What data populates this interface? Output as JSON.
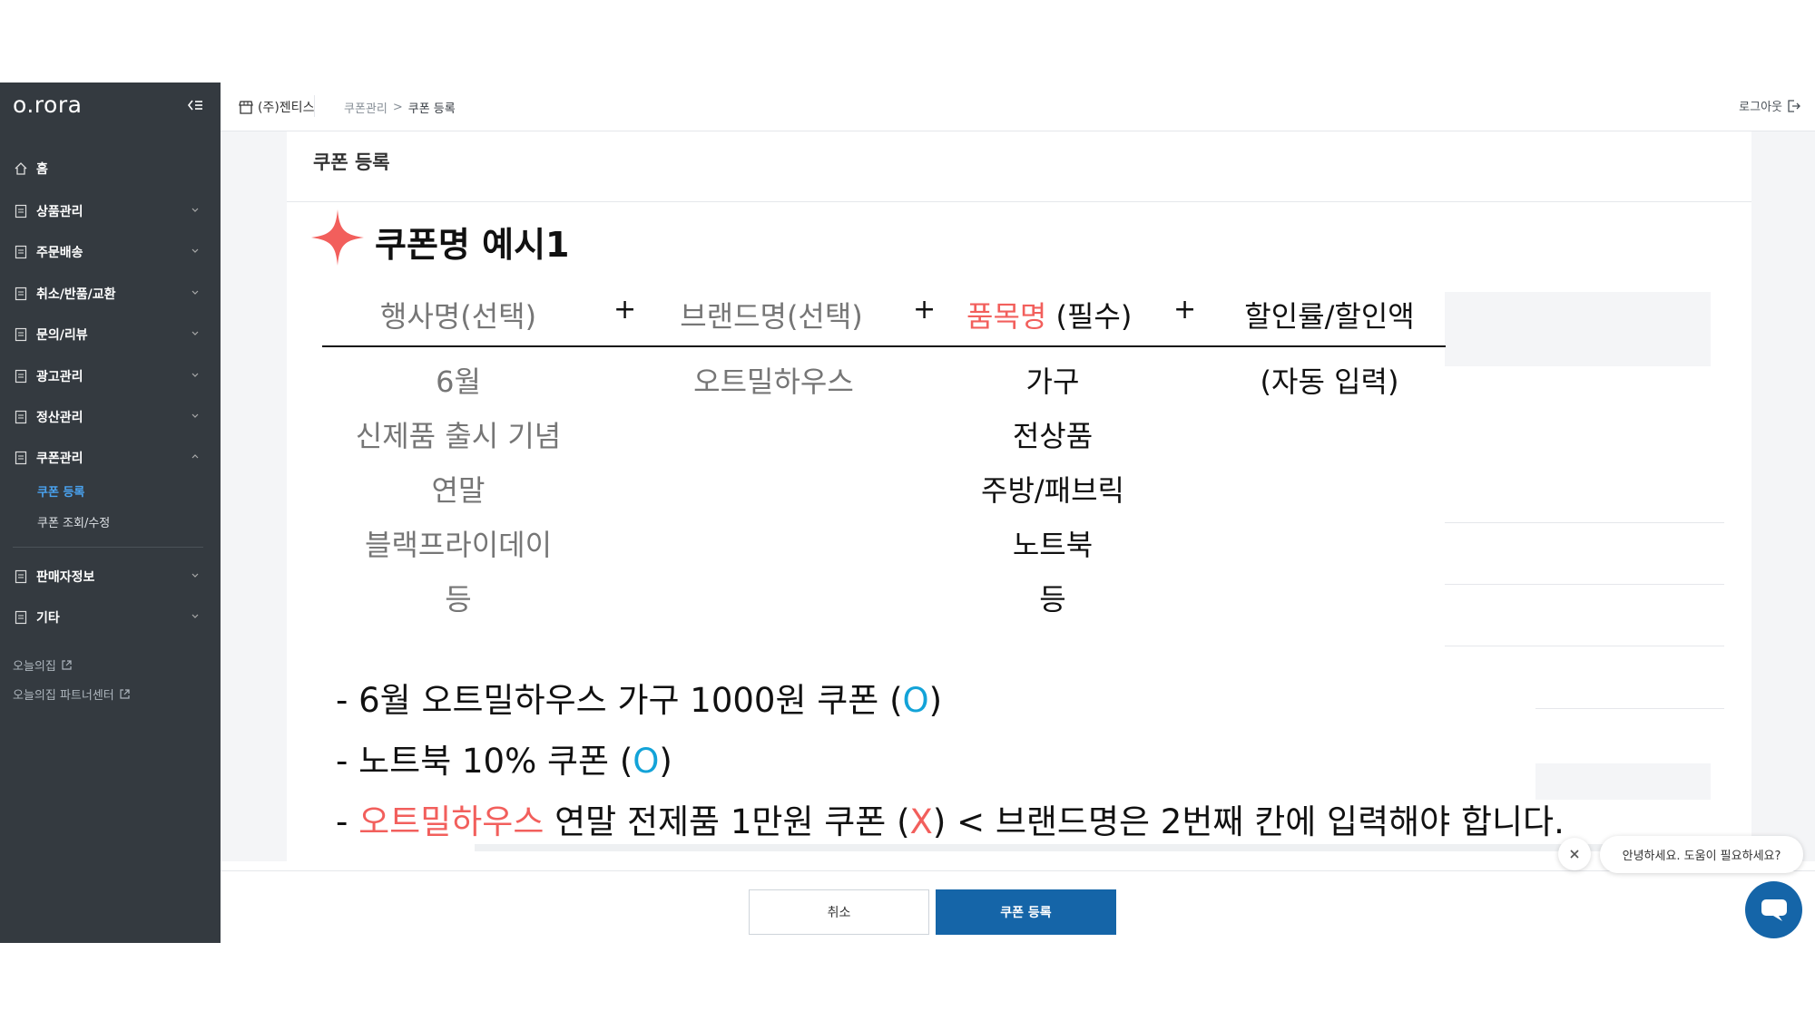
{
  "sidebar": {
    "logo": "o.rora",
    "items": [
      {
        "label": "홈"
      },
      {
        "label": "상품관리"
      },
      {
        "label": "주문배송"
      },
      {
        "label": "취소/반품/교환"
      },
      {
        "label": "문의/리뷰"
      },
      {
        "label": "광고관리"
      },
      {
        "label": "정산관리"
      },
      {
        "label": "쿠폰관리"
      },
      {
        "label": "판매자정보"
      },
      {
        "label": "기타"
      }
    ],
    "coupon_sub": [
      {
        "label": "쿠폰 등록",
        "active": true
      },
      {
        "label": "쿠폰 조회/수정",
        "active": false
      }
    ],
    "links": [
      {
        "label": "오늘의집"
      },
      {
        "label": "오늘의집 파트너센터"
      }
    ]
  },
  "header": {
    "company": "(주)젠티스",
    "breadcrumb": [
      "쿠폰관리",
      "쿠폰 등록"
    ],
    "logout": "로그아웃"
  },
  "page": {
    "title": "쿠폰 등록"
  },
  "example": {
    "title": "쿠폰명 예시1",
    "headers": {
      "event": "행사명(선택)",
      "brand": "브랜드명(선택)",
      "item_red": "품목명",
      "item_black": " (필수)",
      "discount": "할인률/할인액",
      "plus": "+"
    },
    "event_values": [
      "6월",
      "신제품 출시 기념",
      "연말",
      "블랙프라이데이",
      "등"
    ],
    "brand_values": [
      "오트밀하우스"
    ],
    "item_values": [
      "가구",
      "전상품",
      "주방/패브릭",
      "노트북",
      "등"
    ],
    "discount_values": [
      "(자동 입력)"
    ],
    "lines": [
      {
        "pre": "- 6월 오트밀하우스 가구 1000원 쿠폰 (",
        "mark": "O",
        "post": ")"
      },
      {
        "pre": "- 노트북 10% 쿠폰 (",
        "mark": "O",
        "post": ")"
      },
      {
        "dash": "- ",
        "red": "오트밀하우스",
        "mid": " 연말 전제품 1만원 쿠폰 (",
        "mark": "X",
        "post": ") < 브랜드명은 2번째 칸에 입력해야 합니다."
      }
    ],
    "colors": {
      "red": "#f25f5c",
      "blue": "#13a3d8",
      "gray": "#767676"
    }
  },
  "footer": {
    "cancel": "취소",
    "submit": "쿠폰 등록"
  },
  "chat": {
    "message": "안녕하세요. 도움이 필요하세요?"
  },
  "theme": {
    "sidebar_bg": "#343a40",
    "primary": "#1565a8",
    "active_link": "#4aa3f0"
  }
}
